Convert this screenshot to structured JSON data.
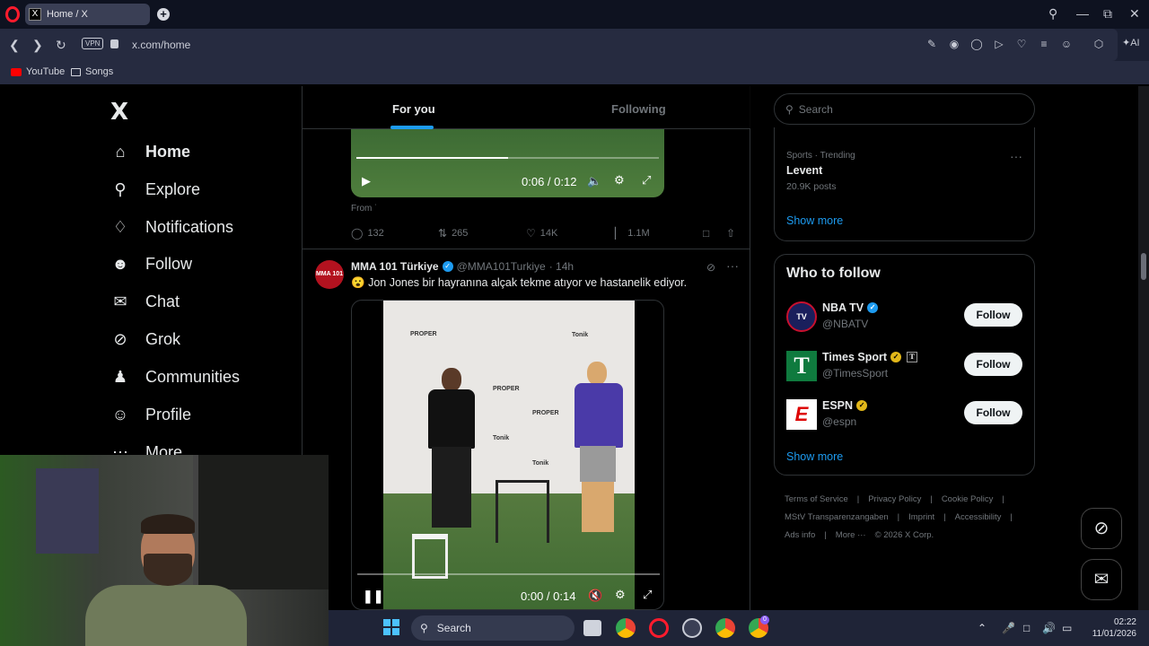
{
  "browser": {
    "tab_title": "Home / X",
    "tab_favicon": "X",
    "url": "x.com/home",
    "vpn_label": "VPN",
    "ai_label": "AI",
    "bookmarks": [
      {
        "label": "YouTube",
        "icon": "youtube-icon"
      },
      {
        "label": "Songs",
        "icon": "folder-icon"
      }
    ]
  },
  "sidebar": {
    "logo": "X",
    "items": [
      {
        "label": "Home",
        "icon": "home-icon"
      },
      {
        "label": "Explore",
        "icon": "search-icon"
      },
      {
        "label": "Notifications",
        "icon": "bell-icon"
      },
      {
        "label": "Follow",
        "icon": "person-add-icon"
      },
      {
        "label": "Chat",
        "icon": "mail-icon"
      },
      {
        "label": "Grok",
        "icon": "grok-icon"
      },
      {
        "label": "Communities",
        "icon": "people-icon"
      },
      {
        "label": "Profile",
        "icon": "person-icon"
      },
      {
        "label": "More",
        "icon": "more-circle-icon"
      }
    ]
  },
  "feed": {
    "tabs": [
      "For you",
      "Following"
    ],
    "post1": {
      "time": "0:06 / 0:12",
      "progress": 0.5,
      "from_label": "From",
      "replies": "132",
      "reposts": "265",
      "likes": "14K",
      "views": "1.1M"
    },
    "post2": {
      "avatar_text": "MMA 101",
      "name": "MMA 101 Türkiye",
      "handle": "@MMA101Turkiye",
      "age": "· 14h",
      "emoji": "😮",
      "text": "Jon Jones bir hayranına alçak tekme atıyor ve hastanelik ediyor.",
      "video_time": "0:00 / 0:14",
      "video_banner": [
        "PROPER",
        "Tonik"
      ]
    }
  },
  "right": {
    "search_placeholder": "Search",
    "trend": {
      "meta": "Sports · Trending",
      "name": "Levent",
      "posts": "20.9K posts"
    },
    "show_more": "Show more",
    "who_to_follow": "Who to follow",
    "accounts": [
      {
        "name": "NBA TV",
        "handle": "@NBATV",
        "badge": "blue"
      },
      {
        "name": "Times Sport",
        "handle": "@TimesSport",
        "badge": "gold",
        "affiliate": "T"
      },
      {
        "name": "ESPN",
        "handle": "@espn",
        "badge": "gold"
      }
    ],
    "follow_label": "Follow",
    "footer": {
      "line1": [
        "Terms of Service",
        "|",
        "Privacy Policy",
        "|",
        "Cookie Policy",
        "|"
      ],
      "line2": [
        "MStV Transparenzangaben",
        "|",
        "Imprint",
        "|",
        "Accessibility",
        "|"
      ],
      "line3": [
        "Ads info",
        "|",
        "More ···",
        "© 2026 X Corp."
      ]
    }
  },
  "taskbar": {
    "search_label": "Search",
    "time": "02:22",
    "date": "11/01/2026",
    "badge_count": "0"
  }
}
